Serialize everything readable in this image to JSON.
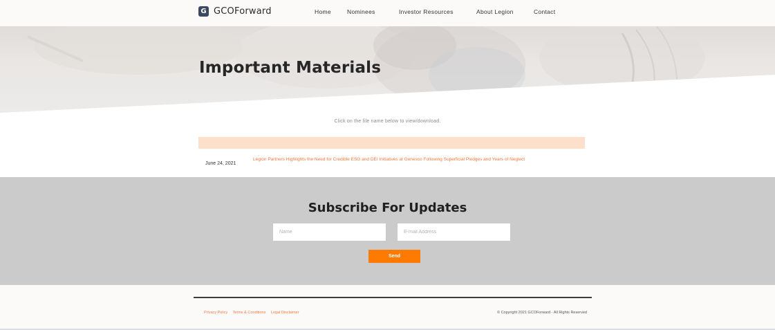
{
  "header": {
    "logo_letter": "G",
    "logo_text": "GCOForward",
    "nav": {
      "home": "Home",
      "nominees": "Nominees",
      "investor_resources": "Investor Resources",
      "about": "About Legion",
      "contact": "Contact"
    }
  },
  "hero": {
    "title": "Important Materials"
  },
  "materials": {
    "instruction": "Click on the file name below to view/download.",
    "rows": [
      {
        "date": "June 24, 2021",
        "title": "Legion Partners Highlights the Need for Credible ESG and DEI Initiatives at Genesco Following Superficial Pledges and Years of Neglect"
      }
    ]
  },
  "subscribe": {
    "title": "Subscribe For Updates",
    "name_placeholder": "Name",
    "email_placeholder": "E-mail Address",
    "send_label": "Send"
  },
  "footer": {
    "links": [
      "Privacy Policy",
      "Terms & Conditions",
      "Legal Disclaimer"
    ],
    "copyright": "© Copyright 2021 GCOForward · All Rights Reserved"
  },
  "colors": {
    "accent": "#ff7a00",
    "link": "#f07a3d",
    "header_band": "#fde0cc",
    "subscribe_bg": "#cbcbcb"
  }
}
